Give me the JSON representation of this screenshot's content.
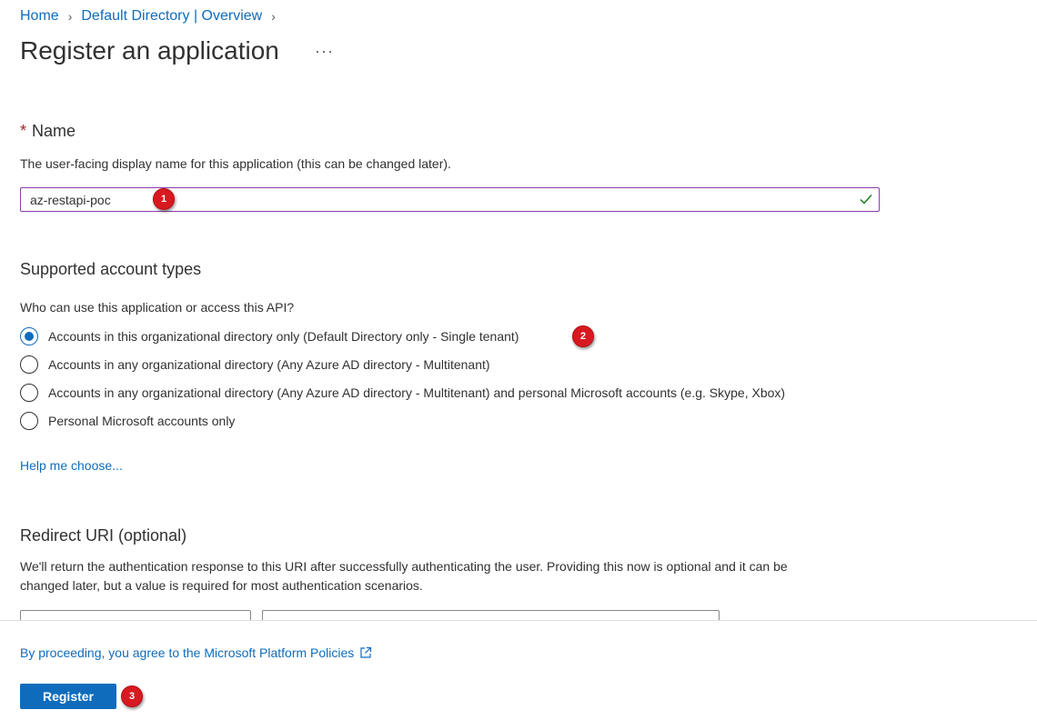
{
  "breadcrumb": [
    {
      "label": "Home"
    },
    {
      "label": "Default Directory | Overview"
    }
  ],
  "page": {
    "title": "Register an application",
    "more_label": "···"
  },
  "name_section": {
    "required_mark": "*",
    "label": "Name",
    "description": "The user-facing display name for this application (this can be changed later).",
    "value": "az-restapi-poc"
  },
  "account_types": {
    "title": "Supported account types",
    "question": "Who can use this application or access this API?",
    "options": [
      {
        "label": "Accounts in this organizational directory only (Default Directory only - Single tenant)",
        "selected": true
      },
      {
        "label": "Accounts in any organizational directory (Any Azure AD directory - Multitenant)",
        "selected": false
      },
      {
        "label": "Accounts in any organizational directory (Any Azure AD directory - Multitenant) and personal Microsoft accounts (e.g. Skype, Xbox)",
        "selected": false
      },
      {
        "label": "Personal Microsoft accounts only",
        "selected": false
      }
    ],
    "help_link": "Help me choose..."
  },
  "redirect": {
    "title": "Redirect URI (optional)",
    "description_line1": "We'll return the authentication response to this URI after successfully authenticating the user. Providing this now is optional and it can be",
    "description_line2": "changed later, but a value is required for most authentication scenarios."
  },
  "footer": {
    "policy_text": "By proceeding, you agree to the Microsoft Platform Policies",
    "register_label": "Register"
  },
  "annotations": {
    "badge1": "1",
    "badge2": "2",
    "badge3": "3"
  },
  "colors": {
    "accent": "#0f6cbd",
    "input_border": "#8a3ea8",
    "badge": "#d71920",
    "success_check": "#107c10"
  }
}
